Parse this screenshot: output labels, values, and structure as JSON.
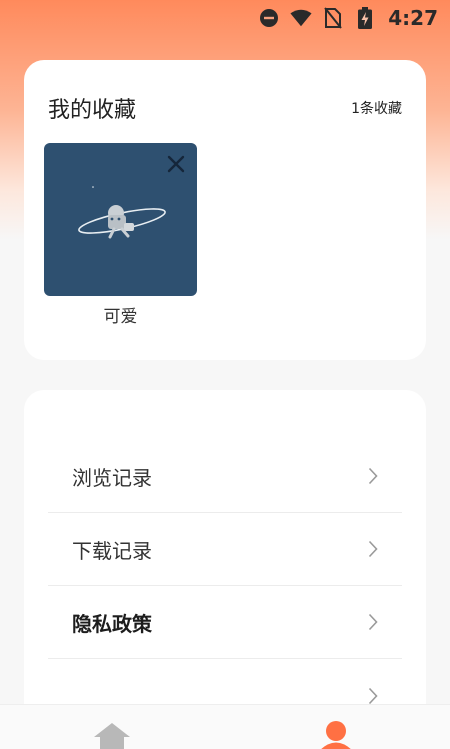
{
  "status_bar": {
    "time": "4:27",
    "icons": [
      "do-not-disturb-icon",
      "wifi-icon",
      "no-sim-icon",
      "battery-charging-icon"
    ]
  },
  "favorites": {
    "title": "我的收藏",
    "count_label": "1条收藏",
    "items": [
      {
        "label": "可爱",
        "thumb_bg": "#2e5070"
      }
    ]
  },
  "menu": {
    "items": [
      {
        "label": "浏览记录"
      },
      {
        "label": "下载记录"
      },
      {
        "label": "隐私政策"
      },
      {
        "label": ""
      }
    ]
  },
  "bottom_nav": {
    "items": [
      "home-icon",
      "profile-icon"
    ],
    "active": "profile-icon",
    "accent": "#ff7043"
  },
  "colors": {
    "header_gradient_top": "#ff8a5c",
    "background": "#f7f7f7",
    "card": "#ffffff"
  }
}
